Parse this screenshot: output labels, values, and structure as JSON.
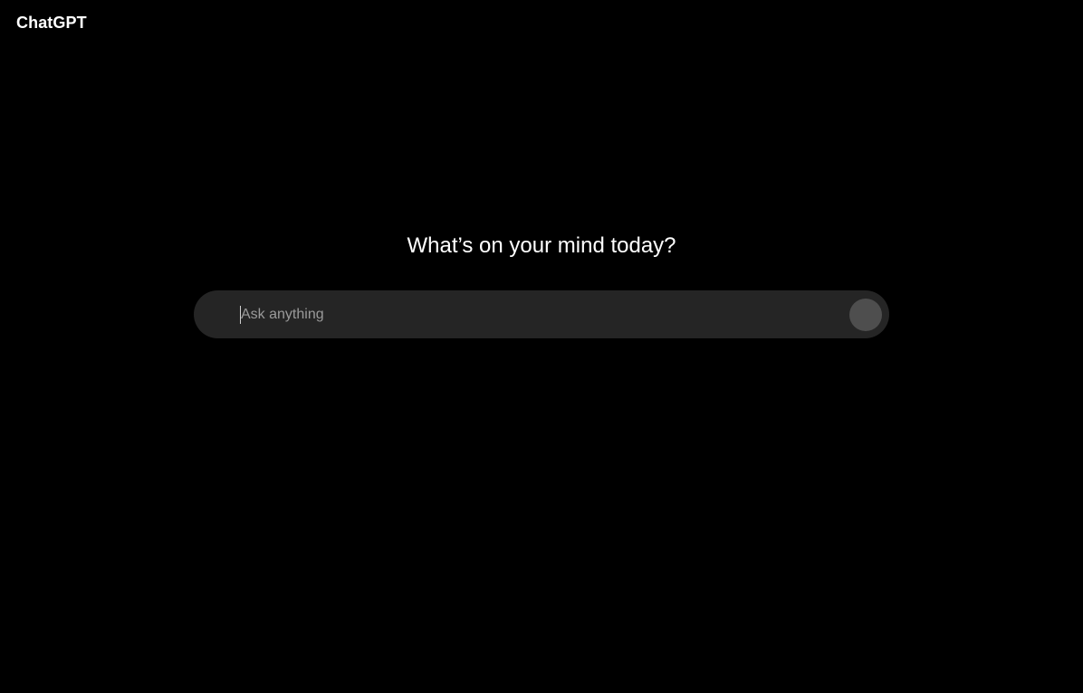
{
  "app": {
    "title": "ChatGPT"
  },
  "main": {
    "headline": "What’s on your mind today?"
  },
  "composer": {
    "placeholder": "Ask anything",
    "value": "",
    "send_icon": "send-icon"
  },
  "colors": {
    "background": "#000000",
    "composer_bg": "#252525",
    "send_button_bg": "#4e4e4e",
    "text_primary": "#ffffff",
    "placeholder_text": "#9a9a9a"
  }
}
